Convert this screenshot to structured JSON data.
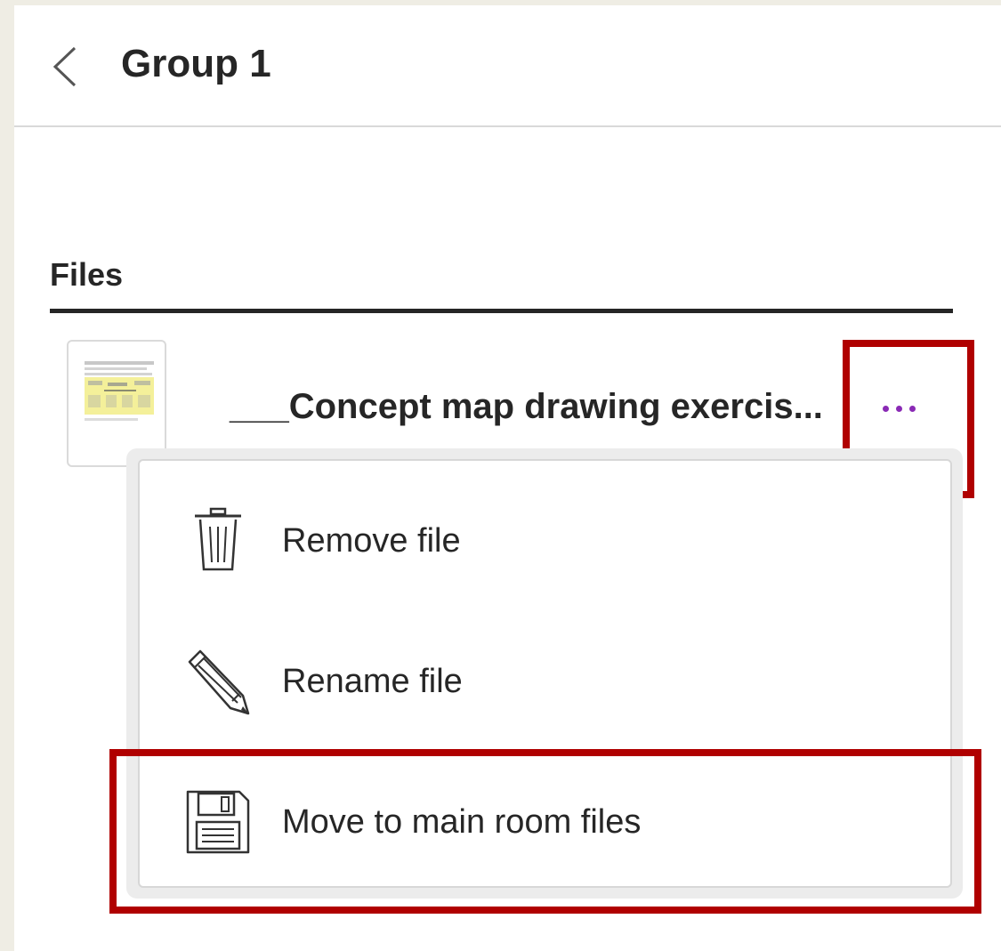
{
  "header": {
    "title": "Group 1",
    "back_icon": "chevron-left-icon"
  },
  "files": {
    "section_label": "Files",
    "items": [
      {
        "name": "___Concept map drawing exercis...",
        "thumbnail_icon": "document-thumbnail",
        "more_icon": "more-horizontal-icon"
      }
    ]
  },
  "context_menu": {
    "items": [
      {
        "label": "Remove file",
        "icon": "trash-icon"
      },
      {
        "label": "Rename file",
        "icon": "pencil-icon"
      },
      {
        "label": "Move to main room files",
        "icon": "save-icon"
      }
    ]
  },
  "colors": {
    "background": "#efede4",
    "panel": "#ffffff",
    "text": "#262626",
    "accent_more": "#8a2ab5",
    "annotation_highlight": "#b00000",
    "divider": "#d9d9d9"
  }
}
